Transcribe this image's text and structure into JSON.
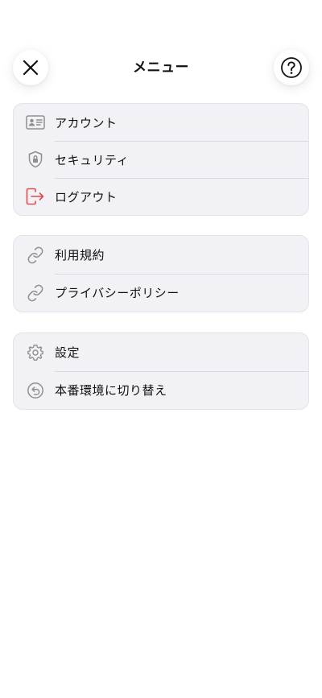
{
  "header": {
    "title": "メニュー",
    "close_icon": "close-icon",
    "help_icon": "help-circle-icon"
  },
  "groups": [
    {
      "items": [
        {
          "label": "アカウント",
          "icon": "id-card-icon"
        },
        {
          "label": "セキュリティ",
          "icon": "shield-lock-icon"
        },
        {
          "label": "ログアウト",
          "icon": "logout-icon",
          "color": "#e5484d"
        }
      ]
    },
    {
      "items": [
        {
          "label": "利用規約",
          "icon": "link-icon"
        },
        {
          "label": "プライバシーポリシー",
          "icon": "link-icon"
        }
      ]
    },
    {
      "items": [
        {
          "label": "設定",
          "icon": "gear-icon"
        },
        {
          "label": "本番環境に切り替え",
          "icon": "undo-circle-icon"
        }
      ]
    }
  ],
  "colors": {
    "icon_gray": "#8e8e93",
    "logout_red": "#e5484d",
    "group_bg": "#f2f2f6"
  }
}
